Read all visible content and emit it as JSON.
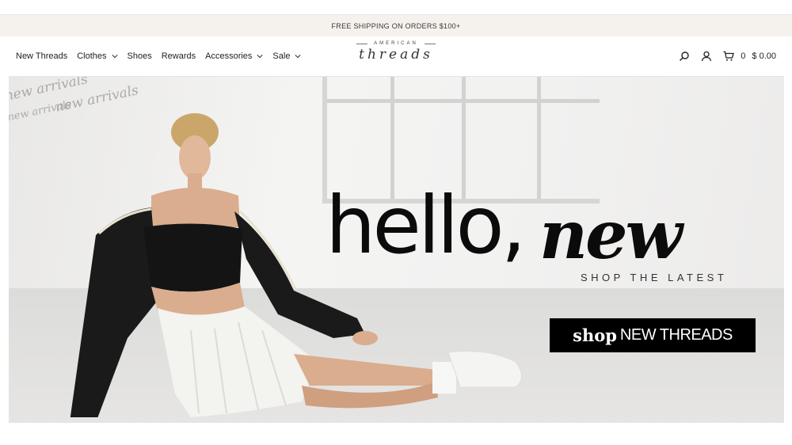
{
  "announcement": {
    "text": "FREE SHIPPING ON ORDERS $100+"
  },
  "nav": {
    "items": [
      {
        "label": "New Threads",
        "has_dropdown": false
      },
      {
        "label": "Clothes",
        "has_dropdown": true
      },
      {
        "label": "Shoes",
        "has_dropdown": false
      },
      {
        "label": "Rewards",
        "has_dropdown": false
      },
      {
        "label": "Accessories",
        "has_dropdown": true
      },
      {
        "label": "Sale",
        "has_dropdown": true
      }
    ]
  },
  "logo": {
    "top": "AMERICAN",
    "script": "threads"
  },
  "utils": {
    "icons": [
      "search-icon",
      "account-icon",
      "cart-icon"
    ],
    "cart_count": "0",
    "cart_total": "$ 0.00"
  },
  "hero": {
    "deco_script": "new arrivals",
    "deco_script_2": "new arrivals",
    "deco_script_3": "new arrivals",
    "headline_1": "hello,",
    "headline_2": "new",
    "subheadline": "SHOP THE LATEST",
    "cta_script": "shop",
    "cta_text": "NEW THREADS"
  },
  "colors": {
    "announcement_bg": "#f5f1ec",
    "cta_bg": "#000000",
    "text": "#222222"
  }
}
